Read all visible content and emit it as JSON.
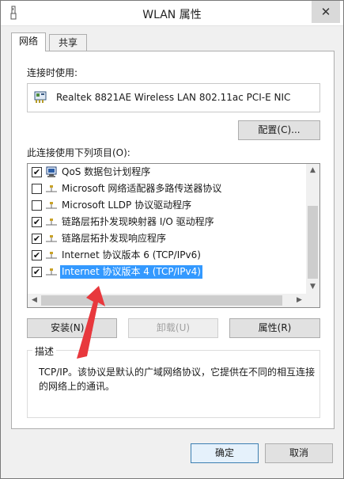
{
  "window": {
    "title": "WLAN 属性",
    "close_label": "✕"
  },
  "tabs": [
    {
      "label": "网络"
    },
    {
      "label": "共享"
    }
  ],
  "connect_using": {
    "label": "连接时使用:",
    "adapter": "Realtek 8821AE Wireless LAN 802.11ac PCI-E NIC",
    "configure_button": "配置(C)..."
  },
  "items_label": "此连接使用下列项目(O):",
  "items": [
    {
      "checked": true,
      "check_mark": "✔",
      "icon": "qos-scheduler-icon",
      "label": "QoS 数据包计划程序"
    },
    {
      "checked": false,
      "check_mark": "",
      "icon": "protocol-icon",
      "label": "Microsoft 网络适配器多路传送器协议"
    },
    {
      "checked": false,
      "check_mark": "",
      "icon": "protocol-icon",
      "label": "Microsoft LLDP 协议驱动程序"
    },
    {
      "checked": true,
      "check_mark": "✔",
      "icon": "protocol-icon",
      "label": "链路层拓扑发现映射器 I/O 驱动程序"
    },
    {
      "checked": true,
      "check_mark": "✔",
      "icon": "protocol-icon",
      "label": "链路层拓扑发现响应程序"
    },
    {
      "checked": true,
      "check_mark": "✔",
      "icon": "protocol-icon",
      "label": "Internet 协议版本 6 (TCP/IPv6)"
    },
    {
      "checked": true,
      "check_mark": "✔",
      "icon": "protocol-icon",
      "label": "Internet 协议版本 4 (TCP/IPv4)",
      "selected": true
    }
  ],
  "actions": {
    "install": "安装(N)...",
    "uninstall": "卸载(U)",
    "properties": "属性(R)"
  },
  "description": {
    "title": "描述",
    "text": "TCP/IP。该协议是默认的广域网络协议，它提供在不同的相互连接的网络上的通讯。"
  },
  "footer": {
    "ok": "确定",
    "cancel": "取消"
  },
  "colors": {
    "selection": "#3399ff",
    "annotation_arrow": "#e8383d",
    "focus_border": "#3c7fb1"
  }
}
